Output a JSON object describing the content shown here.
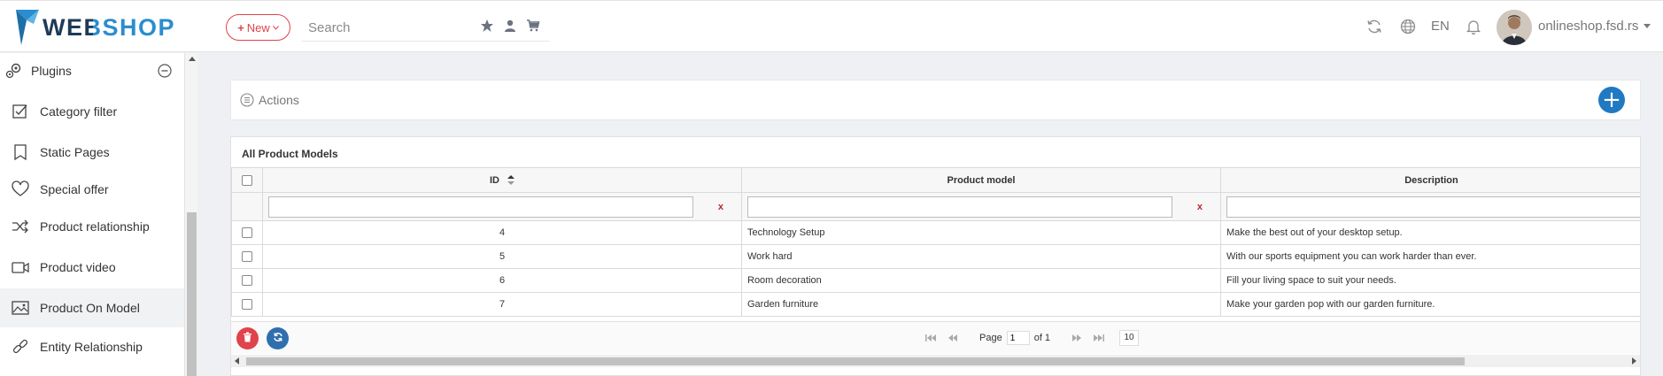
{
  "header": {
    "logo": "WEBSHOP",
    "new_button": "New",
    "search_placeholder": "Search",
    "language": "EN",
    "shop_name": "onlineshop.fsd.rs"
  },
  "sidebar": {
    "section_label": "Plugins",
    "items": [
      {
        "label": "Category filter",
        "icon": "checkbox-edit-icon"
      },
      {
        "label": "Static Pages",
        "icon": "bookmark-icon"
      },
      {
        "label": "Special offer",
        "icon": "heart-icon"
      },
      {
        "label": "Product relationship",
        "icon": "shuffle-icon"
      },
      {
        "label": "Product video",
        "icon": "video-icon"
      },
      {
        "label": "Product On Model",
        "icon": "image-icon"
      },
      {
        "label": "Entity Relationship",
        "icon": "link-icon"
      }
    ],
    "active_item": "Product On Model"
  },
  "actions": {
    "title": "Actions"
  },
  "grid": {
    "title": "All Product Models",
    "columns": [
      "ID",
      "Product model",
      "Description"
    ],
    "filter_clear": "x",
    "rows": [
      {
        "id": "4",
        "product_model": "Technology Setup",
        "description": "Make the best out of your desktop setup."
      },
      {
        "id": "5",
        "product_model": "Work hard",
        "description": "With our sports equipment you can work harder than ever."
      },
      {
        "id": "6",
        "product_model": "Room decoration",
        "description": "Fill your living space to suit your needs."
      },
      {
        "id": "7",
        "product_model": "Garden furniture",
        "description": "Make your garden pop with our garden furniture."
      }
    ],
    "pager": {
      "page_label": "Page",
      "page": "1",
      "of_label": "of 1",
      "page_size": "10"
    }
  },
  "colors": {
    "brand_dark": "#1e3a57",
    "brand_blue": "#2a8dcf",
    "accent_red": "#e0434b",
    "accent_blue": "#2079c1"
  }
}
